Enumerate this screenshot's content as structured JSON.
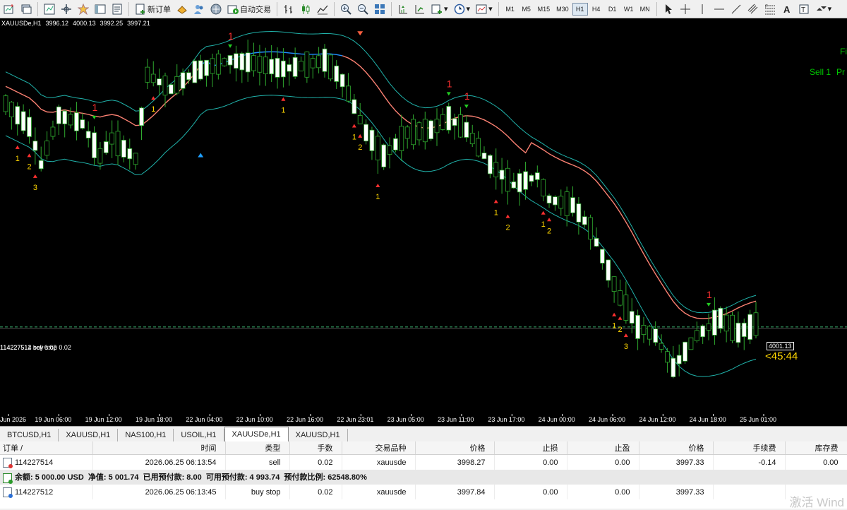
{
  "toolbar": {
    "new_order_label": "新订单",
    "auto_trade_label": "自动交易",
    "timeframes": [
      "M1",
      "M5",
      "M15",
      "M30",
      "H1",
      "H4",
      "D1",
      "W1",
      "MN"
    ],
    "active_timeframe": "H1"
  },
  "chart": {
    "symbol": "XAUUSDe,H1",
    "ohlc": [
      "3996.12",
      "4000.13",
      "3992.25",
      "3997.21"
    ],
    "time_labels": [
      "Jun 2026",
      "19 Jun 06:00",
      "19 Jun 12:00",
      "19 Jun 18:00",
      "22 Jun 04:00",
      "22 Jun 10:00",
      "22 Jun 16:00",
      "22 Jun 23:01",
      "23 Jun 05:00",
      "23 Jun 11:00",
      "23 Jun 17:00",
      "24 Jun 00:00",
      "24 Jun 06:00",
      "24 Jun 12:00",
      "24 Jun 18:00",
      "25 Jun 01:00"
    ],
    "right_label_top": "Fi",
    "right_label_sell": "Sell 1",
    "right_label_pr": "Pr",
    "countdown": "<45:44",
    "position_label": "114227514 sell 0.02",
    "position_label_2": "114227512 buy stop 0.02",
    "current_price": "4001.13",
    "colors": {
      "background": "#000000",
      "candle": "#ffffff",
      "band": "#20b2aa",
      "trend_red": "#fa8072",
      "trend_blue": "#1e90ff",
      "signal_number": "#ffd700"
    }
  },
  "chart_data": {
    "type": "candlestick",
    "symbol": "XAUUSDe",
    "timeframe": "H1",
    "current_price": 4001.13
  },
  "tabs": [
    "BTCUSD,H1",
    "XAUUSD,H1",
    "NAS100,H1",
    "USOIL,H1",
    "XAUUSDe,H1",
    "XAUUSD,H1"
  ],
  "active_tab": "XAUUSDe,H1",
  "orders": {
    "headers": [
      "订单 /",
      "时间",
      "类型",
      "手数",
      "交易品种",
      "价格",
      "止损",
      "止盈",
      "价格",
      "手续费",
      "库存费"
    ],
    "rows": [
      {
        "order": "114227514",
        "time": "2026.06.25 06:13:54",
        "type": "sell",
        "lots": "0.02",
        "symbol": "xauusde",
        "price": "3998.27",
        "sl": "0.00",
        "tp": "0.00",
        "cur_price": "3997.33",
        "commission": "-0.14",
        "swap": "0.00"
      },
      {
        "order": "114227512",
        "time": "2026.06.25 06:13:45",
        "type": "buy stop",
        "lots": "0.02",
        "symbol": "xauusde",
        "price": "3997.84",
        "sl": "0.00",
        "tp": "0.00",
        "cur_price": "3997.33",
        "commission": "",
        "swap": ""
      }
    ],
    "summary": "余额: 5 000.00 USD  净值: 5 001.74  已用预付款: 8.00  可用预付款: 4 993.74  预付款比例: 62548.80%"
  },
  "watermark": "激活 Wind"
}
